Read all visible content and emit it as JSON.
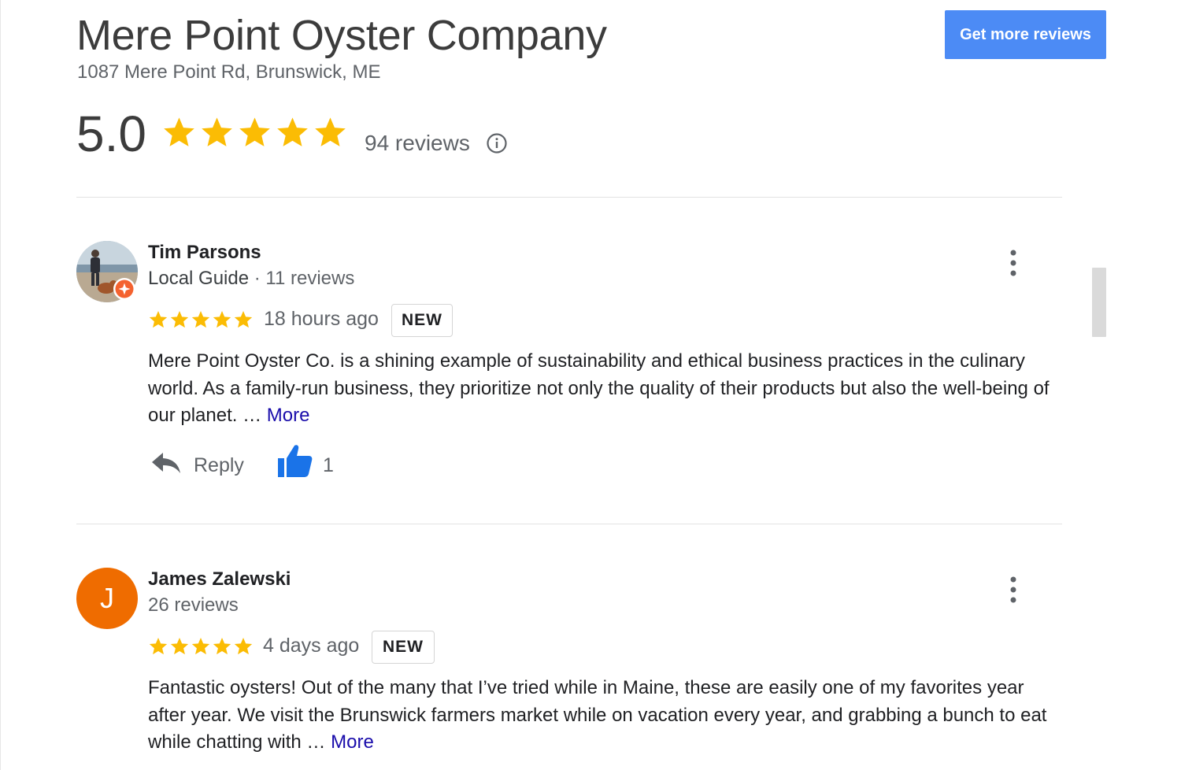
{
  "business": {
    "name": "Mere Point Oyster Company",
    "address": "1087 Mere Point Rd, Brunswick, ME",
    "rating": "5.0",
    "rating_stars": 5,
    "review_count": "94 reviews",
    "get_more_reviews_label": "Get more reviews"
  },
  "colors": {
    "star": "#fbbc04",
    "button": "#4c8bf5",
    "link": "#1a0dab",
    "avatar_orange": "#ef6c00",
    "thumb_blue": "#1a73e8"
  },
  "reviews": [
    {
      "name": "Tim Parsons",
      "badge": "Local Guide",
      "separator": " · ",
      "count": "11 reviews",
      "stars": 5,
      "time": "18 hours ago",
      "tag": "NEW",
      "text": "Mere Point Oyster Co. is a shining example of sustainability and ethical business practices in the culinary world. As a family-run business, they prioritize not only the quality of their products but also the well-being of our planet. …",
      "more": "More",
      "reply": "Reply",
      "likes": "1"
    },
    {
      "name": "James Zalewski",
      "avatar_letter": "J",
      "count": "26 reviews",
      "stars": 5,
      "time": "4 days ago",
      "tag": "NEW",
      "text": "Fantastic oysters!  Out of the many that I’ve tried while in Maine, these are easily one of my favorites year after year.  We visit the Brunswick farmers market while on vacation every year, and grabbing a bunch to eat while chatting with …",
      "more": "More"
    }
  ]
}
